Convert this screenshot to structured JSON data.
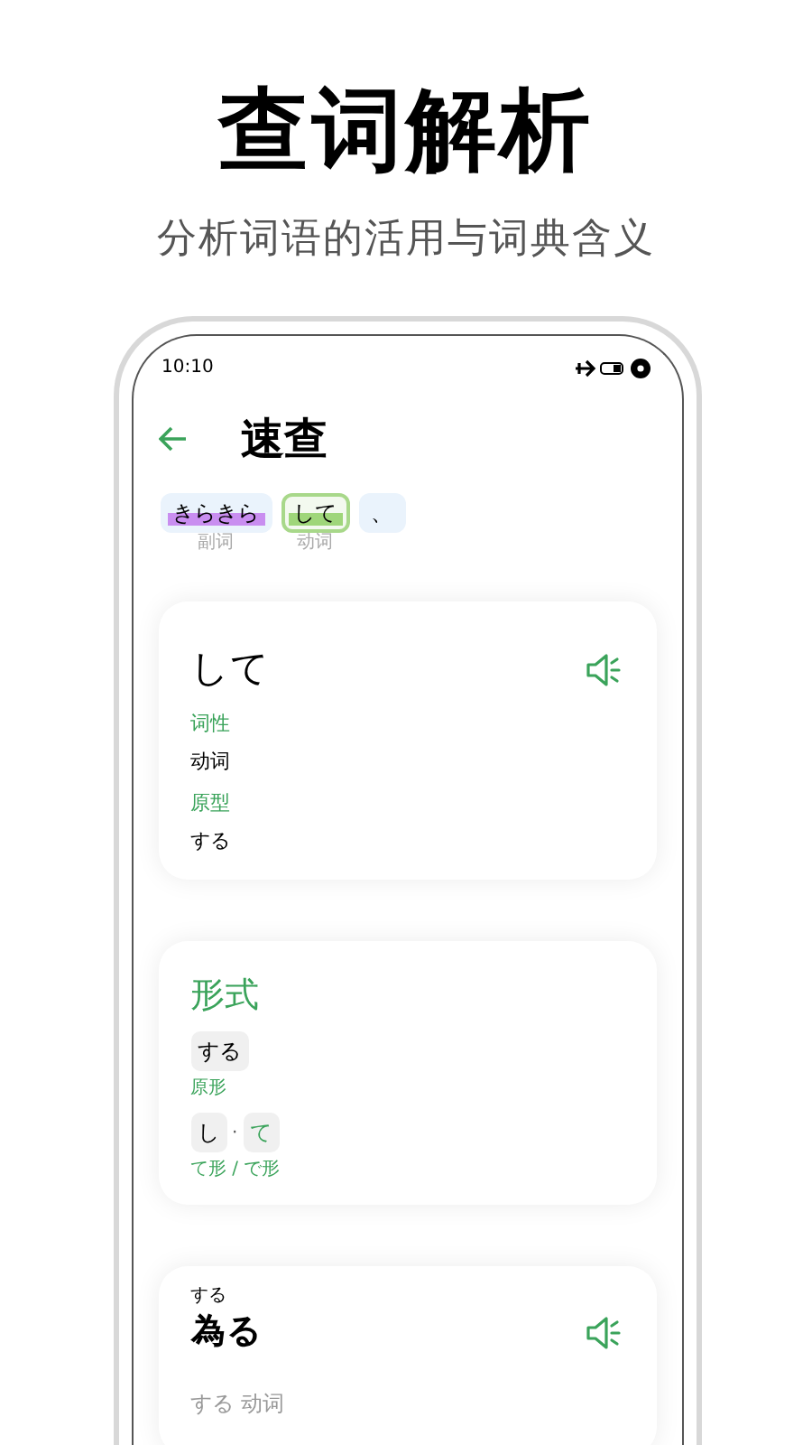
{
  "headline": "查词解析",
  "subtitle": "分析词语的活用与词典含义",
  "status_bar": {
    "time": "10:10"
  },
  "header": {
    "title": "速查"
  },
  "tokens": [
    {
      "text": "きらきら",
      "pos": "副词",
      "color": "#c98ef0",
      "selected": false
    },
    {
      "text": "して",
      "pos": "动词",
      "color": "#9fd67a",
      "selected": true
    },
    {
      "text": "、",
      "selected": false
    }
  ],
  "word_card": {
    "word": "して",
    "fields": [
      {
        "label": "词性",
        "value": "动词"
      },
      {
        "label": "原型",
        "value": "する"
      }
    ]
  },
  "forms_card": {
    "title": "形式",
    "forms": [
      {
        "parts": [
          {
            "text": "する",
            "highlight": false
          }
        ],
        "label": "原形"
      },
      {
        "parts": [
          {
            "text": "し",
            "highlight": false
          },
          {
            "text": "て",
            "highlight": true
          }
        ],
        "separator": "·",
        "label": "て形 / で形"
      }
    ]
  },
  "entry_card": {
    "kanji": "為",
    "reading": "する",
    "okurigana": "る",
    "summary": "する 动词"
  }
}
